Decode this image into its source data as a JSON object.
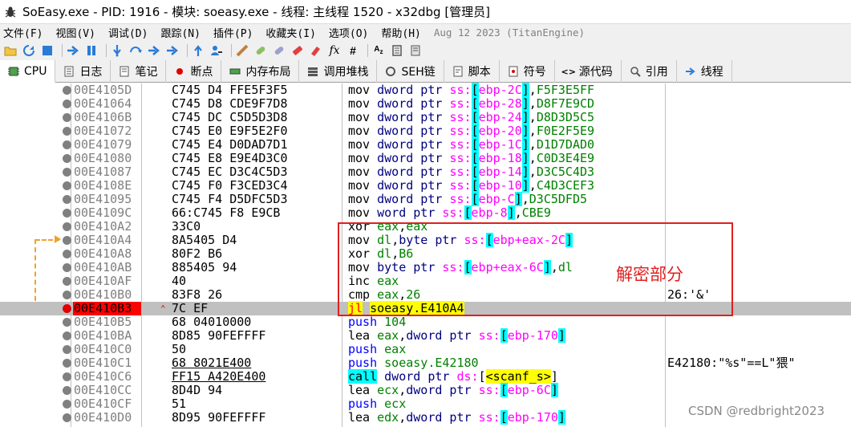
{
  "window": {
    "title": "SoEasy.exe - PID: 1916 - 模块: soeasy.exe - 线程: 主线程 1520 - x32dbg [管理员]"
  },
  "menu": [
    {
      "label": "文件(F)"
    },
    {
      "label": "视图(V)"
    },
    {
      "label": "调试(D)"
    },
    {
      "label": "跟踪(N)"
    },
    {
      "label": "插件(P)"
    },
    {
      "label": "收藏夹(I)"
    },
    {
      "label": "选项(O)"
    },
    {
      "label": "帮助(H)"
    }
  ],
  "menu_date": "Aug 12 2023 (TitanEngine)",
  "toolbar_icons": [
    "open-icon",
    "restart-icon",
    "stop-icon",
    "run-icon",
    "pause-icon",
    "step-into-icon",
    "step-over-icon",
    "trace-into-icon",
    "trace-over-icon",
    "execute-till-return-icon",
    "run-to-user-code-icon",
    "scylla-icon",
    "patch-icon",
    "comment-icon",
    "label-icon",
    "bookmark-icon",
    "function-icon",
    "hash-icon",
    "strings-icon",
    "calculator-icon",
    "notes-icon"
  ],
  "tabs": [
    {
      "label": "CPU",
      "icon": "cpu-icon",
      "active": true
    },
    {
      "label": "日志",
      "icon": "log-icon"
    },
    {
      "label": "笔记",
      "icon": "notes-icon"
    },
    {
      "label": "断点",
      "icon": "breakpoint-icon"
    },
    {
      "label": "内存布局",
      "icon": "memory-icon"
    },
    {
      "label": "调用堆栈",
      "icon": "callstack-icon"
    },
    {
      "label": "SEH链",
      "icon": "seh-icon"
    },
    {
      "label": "脚本",
      "icon": "script-icon"
    },
    {
      "label": "符号",
      "icon": "symbol-icon"
    },
    {
      "label": "源代码",
      "icon": "source-icon"
    },
    {
      "label": "引用",
      "icon": "references-icon"
    },
    {
      "label": "线程",
      "icon": "threads-icon"
    }
  ],
  "disassembly": [
    {
      "addr": "00E4105D",
      "bytes": "C745 D4 FFE5F3F5",
      "asm": "mov dword ptr ss:[ebp-2C],F5F3E5FF"
    },
    {
      "addr": "00E41064",
      "bytes": "C745 D8 CDE9F7D8",
      "asm": "mov dword ptr ss:[ebp-28],D8F7E9CD"
    },
    {
      "addr": "00E4106B",
      "bytes": "C745 DC C5D5D3D8",
      "asm": "mov dword ptr ss:[ebp-24],D8D3D5C5"
    },
    {
      "addr": "00E41072",
      "bytes": "C745 E0 E9F5E2F0",
      "asm": "mov dword ptr ss:[ebp-20],F0E2F5E9"
    },
    {
      "addr": "00E41079",
      "bytes": "C745 E4 D0DAD7D1",
      "asm": "mov dword ptr ss:[ebp-1C],D1D7DAD0"
    },
    {
      "addr": "00E41080",
      "bytes": "C745 E8 E9E4D3C0",
      "asm": "mov dword ptr ss:[ebp-18],C0D3E4E9"
    },
    {
      "addr": "00E41087",
      "bytes": "C745 EC D3C4C5D3",
      "asm": "mov dword ptr ss:[ebp-14],D3C5C4D3"
    },
    {
      "addr": "00E4108E",
      "bytes": "C745 F0 F3CED3C4",
      "asm": "mov dword ptr ss:[ebp-10],C4D3CEF3"
    },
    {
      "addr": "00E41095",
      "bytes": "C745 F4 D5DFC5D3",
      "asm": "mov dword ptr ss:[ebp-C],D3C5DFD5"
    },
    {
      "addr": "00E4109C",
      "bytes": "66:C745 F8 E9CB",
      "asm": "mov word ptr ss:[ebp-8],CBE9"
    },
    {
      "addr": "00E410A2",
      "bytes": "33C0",
      "asm": "xor eax,eax"
    },
    {
      "addr": "00E410A4",
      "bytes": "8A5405 D4",
      "asm": "mov dl,byte ptr ss:[ebp+eax-2C]"
    },
    {
      "addr": "00E410A8",
      "bytes": "80F2 B6",
      "asm": "xor dl,B6"
    },
    {
      "addr": "00E410AB",
      "bytes": "885405 94",
      "asm": "mov byte ptr ss:[ebp+eax-6C],dl"
    },
    {
      "addr": "00E410AF",
      "bytes": "40",
      "asm": "inc eax"
    },
    {
      "addr": "00E410B0",
      "bytes": "83F8 26",
      "asm": "cmp eax,26",
      "comment": "26:'&'"
    },
    {
      "addr": "00E410B3",
      "bytes": "7C EF",
      "asm": "jl soeasy.E410A4"
    },
    {
      "addr": "00E410B5",
      "bytes": "68 04010000",
      "asm": "push 104"
    },
    {
      "addr": "00E410BA",
      "bytes": "8D85 90FEFFFF",
      "asm": "lea eax,dword ptr ss:[ebp-170]"
    },
    {
      "addr": "00E410C0",
      "bytes": "50",
      "asm": "push eax"
    },
    {
      "addr": "00E410C1",
      "bytes": "68 8021E400",
      "asm": "push soeasy.E42180",
      "comment": "E42180:\"%s\"==L\"猥\""
    },
    {
      "addr": "00E410C6",
      "bytes": "FF15 A420E400",
      "asm": "call dword ptr ds:[<scanf_s>]"
    },
    {
      "addr": "00E410CC",
      "bytes": "8D4D 94",
      "asm": "lea ecx,dword ptr ss:[ebp-6C]"
    },
    {
      "addr": "00E410CF",
      "bytes": "51",
      "asm": "push ecx"
    },
    {
      "addr": "00E410D0",
      "bytes": "8D95 90FEFFFF",
      "asm": "lea edx,dword ptr ss:[ebp-170]"
    }
  ],
  "annotation": "解密部分",
  "watermark": "CSDN @redbright2023",
  "colors": {
    "eip_bg": "#ff0000",
    "annotation": "#e02020",
    "jump_arrow": "#f0a030"
  }
}
